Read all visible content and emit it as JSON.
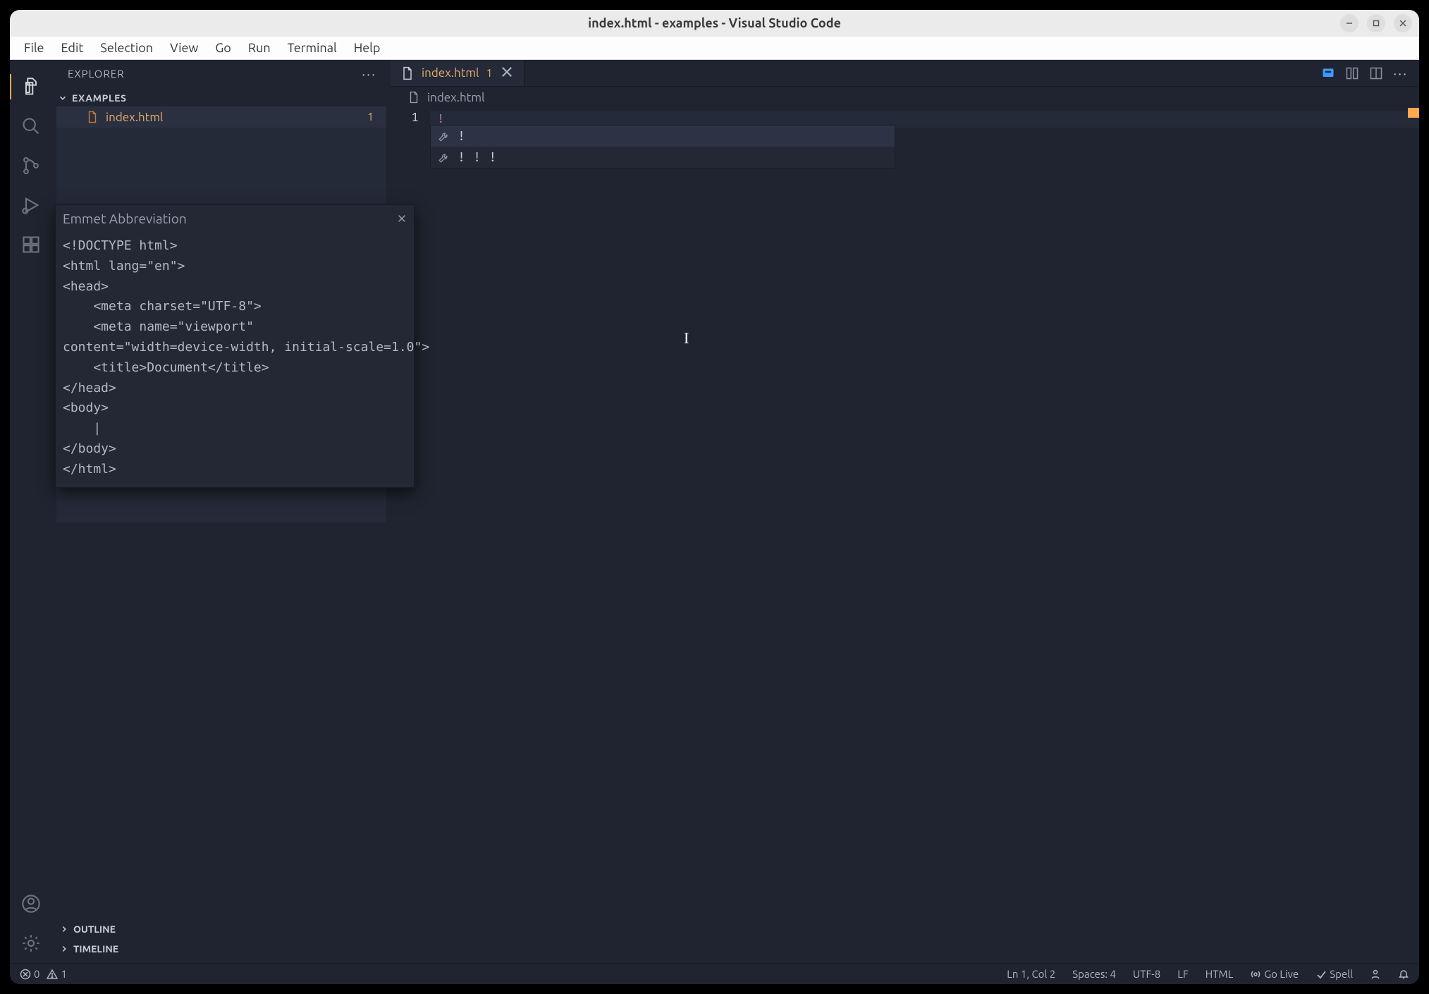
{
  "window": {
    "title": "index.html - examples - Visual Studio Code"
  },
  "menu": [
    "File",
    "Edit",
    "Selection",
    "View",
    "Go",
    "Run",
    "Terminal",
    "Help"
  ],
  "activity": {
    "items": [
      "explorer",
      "search",
      "source-control",
      "run-debug",
      "extensions"
    ],
    "bottom": [
      "accounts",
      "manage"
    ]
  },
  "sidebar": {
    "title": "EXPLORER",
    "section": "EXAMPLES",
    "file": {
      "name": "index.html",
      "badge": "1"
    },
    "outline": "OUTLINE",
    "timeline": "TIMELINE"
  },
  "tabs": {
    "active": {
      "name": "index.html",
      "badge": "1"
    }
  },
  "breadcrumb": {
    "file": "index.html"
  },
  "editor": {
    "line_number": "1",
    "content": "!"
  },
  "suggest": {
    "items": [
      {
        "label": "!"
      },
      {
        "label": "! ! !"
      }
    ]
  },
  "emmet": {
    "title": "Emmet Abbreviation",
    "body": "<!DOCTYPE html>\n<html lang=\"en\">\n<head>\n    <meta charset=\"UTF-8\">\n    <meta name=\"viewport\"\ncontent=\"width=device-width, initial-scale=1.0\">\n    <title>Document</title>\n</head>\n<body>\n    |\n</body>\n</html>"
  },
  "status": {
    "errors": "0",
    "warnings": "1",
    "ln_col": "Ln 1, Col 2",
    "spaces": "Spaces: 4",
    "encoding": "UTF-8",
    "eol": "LF",
    "lang": "HTML",
    "golive": "Go Live",
    "spell": "Spell"
  }
}
